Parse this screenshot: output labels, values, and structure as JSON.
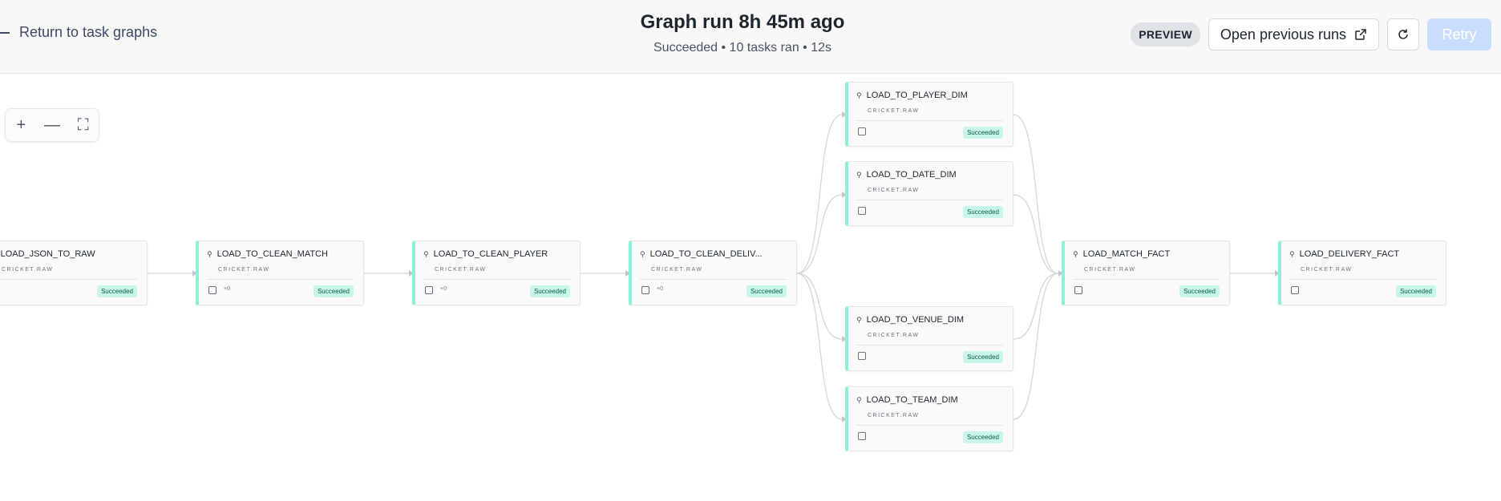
{
  "header": {
    "back_label": "Return to task graphs",
    "title": "Graph run 8h 45m ago",
    "subtitle": "Succeeded • 10 tasks ran • 12s",
    "badge": "PREVIEW",
    "open_previous_label": "Open previous runs",
    "retry_label": "Retry"
  },
  "zoom": {
    "plus": "+",
    "minus": "—",
    "fit": "⛶"
  },
  "colors": {
    "accent": "#8ff0d9",
    "status_bg": "#c9f6ea",
    "retry_bg": "#c8defc"
  },
  "nodes": [
    {
      "name": "LOAD_JSON_TO_RAW",
      "schema": "CRICKET.RAW",
      "status": "Succeeded",
      "extra": ""
    },
    {
      "name": "LOAD_TO_CLEAN_MATCH",
      "schema": "CRICKET.RAW",
      "status": "Succeeded",
      "extra": "+0"
    },
    {
      "name": "LOAD_TO_CLEAN_PLAYER",
      "schema": "CRICKET.RAW",
      "status": "Succeeded",
      "extra": "+0"
    },
    {
      "name": "LOAD_TO_CLEAN_DELIV...",
      "schema": "CRICKET.RAW",
      "status": "Succeeded",
      "extra": "+0"
    },
    {
      "name": "LOAD_TO_PLAYER_DIM",
      "schema": "CRICKET.RAW",
      "status": "Succeeded",
      "extra": ""
    },
    {
      "name": "LOAD_TO_DATE_DIM",
      "schema": "CRICKET.RAW",
      "status": "Succeeded",
      "extra": ""
    },
    {
      "name": "LOAD_TO_VENUE_DIM",
      "schema": "CRICKET.RAW",
      "status": "Succeeded",
      "extra": ""
    },
    {
      "name": "LOAD_TO_TEAM_DIM",
      "schema": "CRICKET.RAW",
      "status": "Succeeded",
      "extra": ""
    },
    {
      "name": "LOAD_MATCH_FACT",
      "schema": "CRICKET.RAW",
      "status": "Succeeded",
      "extra": ""
    },
    {
      "name": "LOAD_DELIVERY_FACT",
      "schema": "CRICKET.RAW",
      "status": "Succeeded",
      "extra": ""
    }
  ]
}
